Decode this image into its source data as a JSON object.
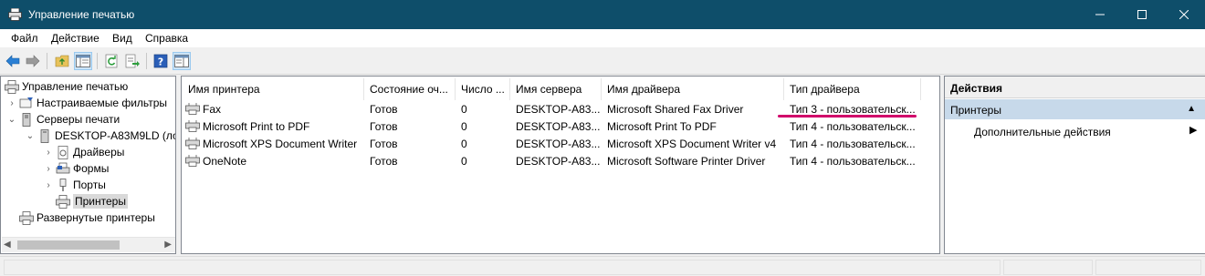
{
  "window": {
    "title": "Управление печатью"
  },
  "menu": [
    "Файл",
    "Действие",
    "Вид",
    "Справка"
  ],
  "toolbar_icons": [
    "back-icon",
    "forward-icon",
    "up-folder-icon",
    "show-hide-tree-icon",
    "refresh-icon",
    "export-list-icon",
    "help-icon",
    "show-hide-action-pane-icon"
  ],
  "tree": {
    "root": "Управление печатью",
    "custom_filters": "Настраиваемые фильтры",
    "print_servers": "Серверы печати",
    "server": "DESKTOP-A83M9LD (ло",
    "drivers": "Драйверы",
    "forms": "Формы",
    "ports": "Порты",
    "printers": "Принтеры",
    "deployed": "Развернутые принтеры"
  },
  "columns": [
    "Имя принтера",
    "Состояние оч...",
    "Число ...",
    "Имя сервера",
    "Имя драйвера",
    "Тип драйвера"
  ],
  "rows": [
    {
      "name": "Fax",
      "status": "Готов",
      "jobs": "0",
      "server": "DESKTOP-A83...",
      "driver": "Microsoft Shared Fax Driver",
      "type": "Тип 3 - пользовательск..."
    },
    {
      "name": "Microsoft Print to PDF",
      "status": "Готов",
      "jobs": "0",
      "server": "DESKTOP-A83...",
      "driver": "Microsoft Print To PDF",
      "type": "Тип 4 - пользовательск..."
    },
    {
      "name": "Microsoft XPS Document Writer",
      "status": "Готов",
      "jobs": "0",
      "server": "DESKTOP-A83...",
      "driver": "Microsoft XPS Document Writer v4",
      "type": "Тип 4 - пользовательск..."
    },
    {
      "name": "OneNote",
      "status": "Готов",
      "jobs": "0",
      "server": "DESKTOP-A83...",
      "driver": "Microsoft Software Printer Driver",
      "type": "Тип 4 - пользовательск..."
    }
  ],
  "actions": {
    "header": "Действия",
    "section": "Принтеры",
    "item": "Дополнительные действия"
  },
  "colors": {
    "titlebar": "#0e4e6a",
    "highlight_mark": "#d1006a",
    "action_section": "#c7d9ea"
  }
}
